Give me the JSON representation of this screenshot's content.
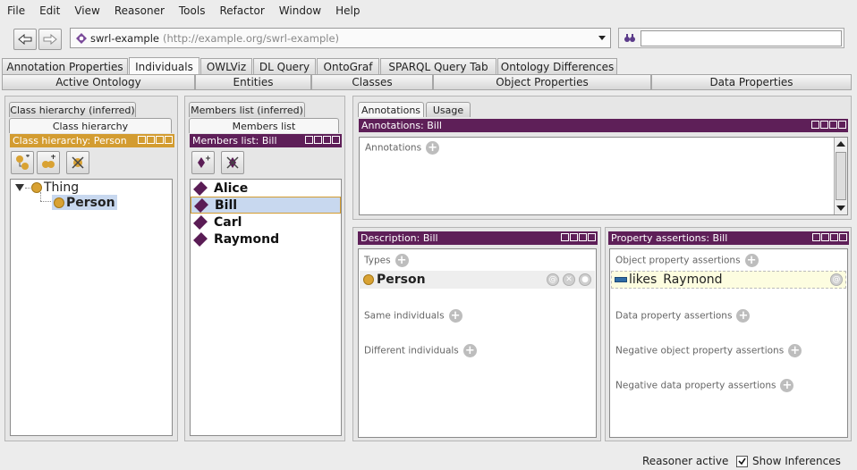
{
  "menu": [
    "File",
    "Edit",
    "View",
    "Reasoner",
    "Tools",
    "Refactor",
    "Window",
    "Help"
  ],
  "toolbar": {
    "ontology_name": "swrl-example",
    "ontology_iri": "(http://example.org/swrl-example)",
    "search_value": ""
  },
  "tabs": [
    "Annotation Properties",
    "Individuals",
    "OWLViz",
    "DL Query",
    "OntoGraf",
    "SPARQL Query Tab",
    "Ontology Differences"
  ],
  "subtabs": [
    "Active Ontology",
    "Entities",
    "Classes",
    "Object Properties",
    "Data Properties"
  ],
  "class_panel": {
    "tab_inferred": "Class hierarchy (inferred)",
    "tab_asserted": "Class hierarchy",
    "header": "Class hierarchy: Person",
    "tree": [
      "Thing",
      "Person"
    ]
  },
  "members_panel": {
    "tab_inferred": "Members list (inferred)",
    "tab_asserted": "Members list",
    "header": "Members list: Bill",
    "individuals": [
      "Alice",
      "Bill",
      "Carl",
      "Raymond"
    ],
    "selected": "Bill"
  },
  "annotations_panel": {
    "tab_annotations": "Annotations",
    "tab_usage": "Usage",
    "header": "Annotations: Bill",
    "label": "Annotations"
  },
  "description_panel": {
    "header": "Description: Bill",
    "types_label": "Types",
    "type_value": "Person",
    "same_label": "Same individuals",
    "different_label": "Different individuals"
  },
  "property_panel": {
    "header": "Property assertions: Bill",
    "object_label": "Object property assertions",
    "assertion_property": "likes",
    "assertion_value": "Raymond",
    "data_label": "Data property assertions",
    "neg_object_label": "Negative object property assertions",
    "neg_data_label": "Negative data property assertions"
  },
  "status": {
    "reasoner": "Reasoner active",
    "show_inferences": "Show Inferences",
    "show_inferences_checked": true
  },
  "colors": {
    "view_header": "#5e1f58",
    "class_header": "#d39c31",
    "selection": "#c8d8ef"
  }
}
